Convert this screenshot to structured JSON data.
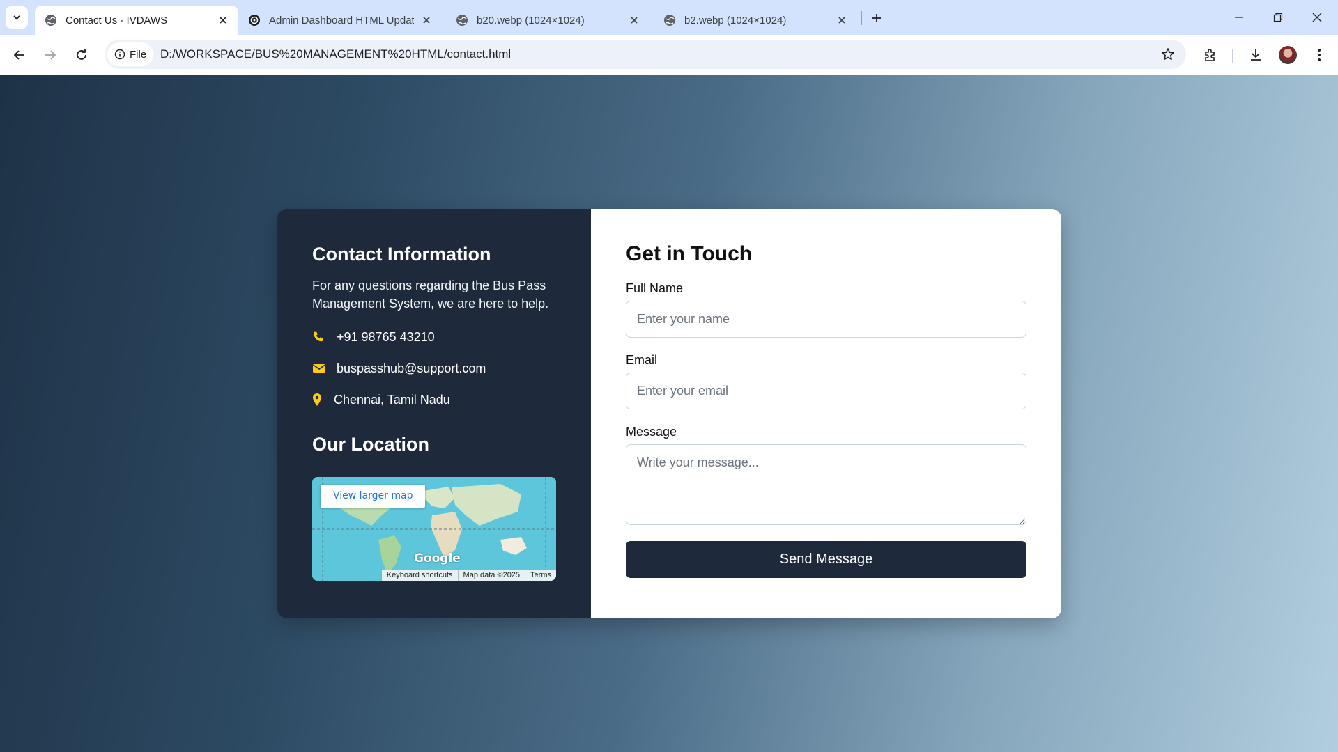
{
  "browser": {
    "tabs": [
      {
        "title": "Contact Us - IVDAWS",
        "active": true
      },
      {
        "title": "Admin Dashboard HTML Update",
        "active": false
      },
      {
        "title": "b20.webp (1024×1024)",
        "active": false
      },
      {
        "title": "b2.webp (1024×1024)",
        "active": false
      }
    ],
    "chip_label": "File",
    "url": "D:/WORKSPACE/BUS%20MANAGEMENT%20HTML/contact.html"
  },
  "contact": {
    "title": "Contact Information",
    "lead": "For any questions regarding the Bus Pass Management System, we are here to help.",
    "phone": "+91 98765 43210",
    "email": "buspasshub@support.com",
    "location": "Chennai, Tamil Nadu",
    "location_title": "Our Location",
    "map": {
      "button": "View larger map",
      "logo": "Google",
      "footer": [
        "Keyboard shortcuts",
        "Map data ©2025",
        "Terms"
      ]
    },
    "accent_color": "#facc15"
  },
  "form": {
    "title": "Get in Touch",
    "name_label": "Full Name",
    "name_placeholder": "Enter your name",
    "email_label": "Email",
    "email_placeholder": "Enter your email",
    "message_label": "Message",
    "message_placeholder": "Write your message...",
    "submit": "Send Message"
  }
}
